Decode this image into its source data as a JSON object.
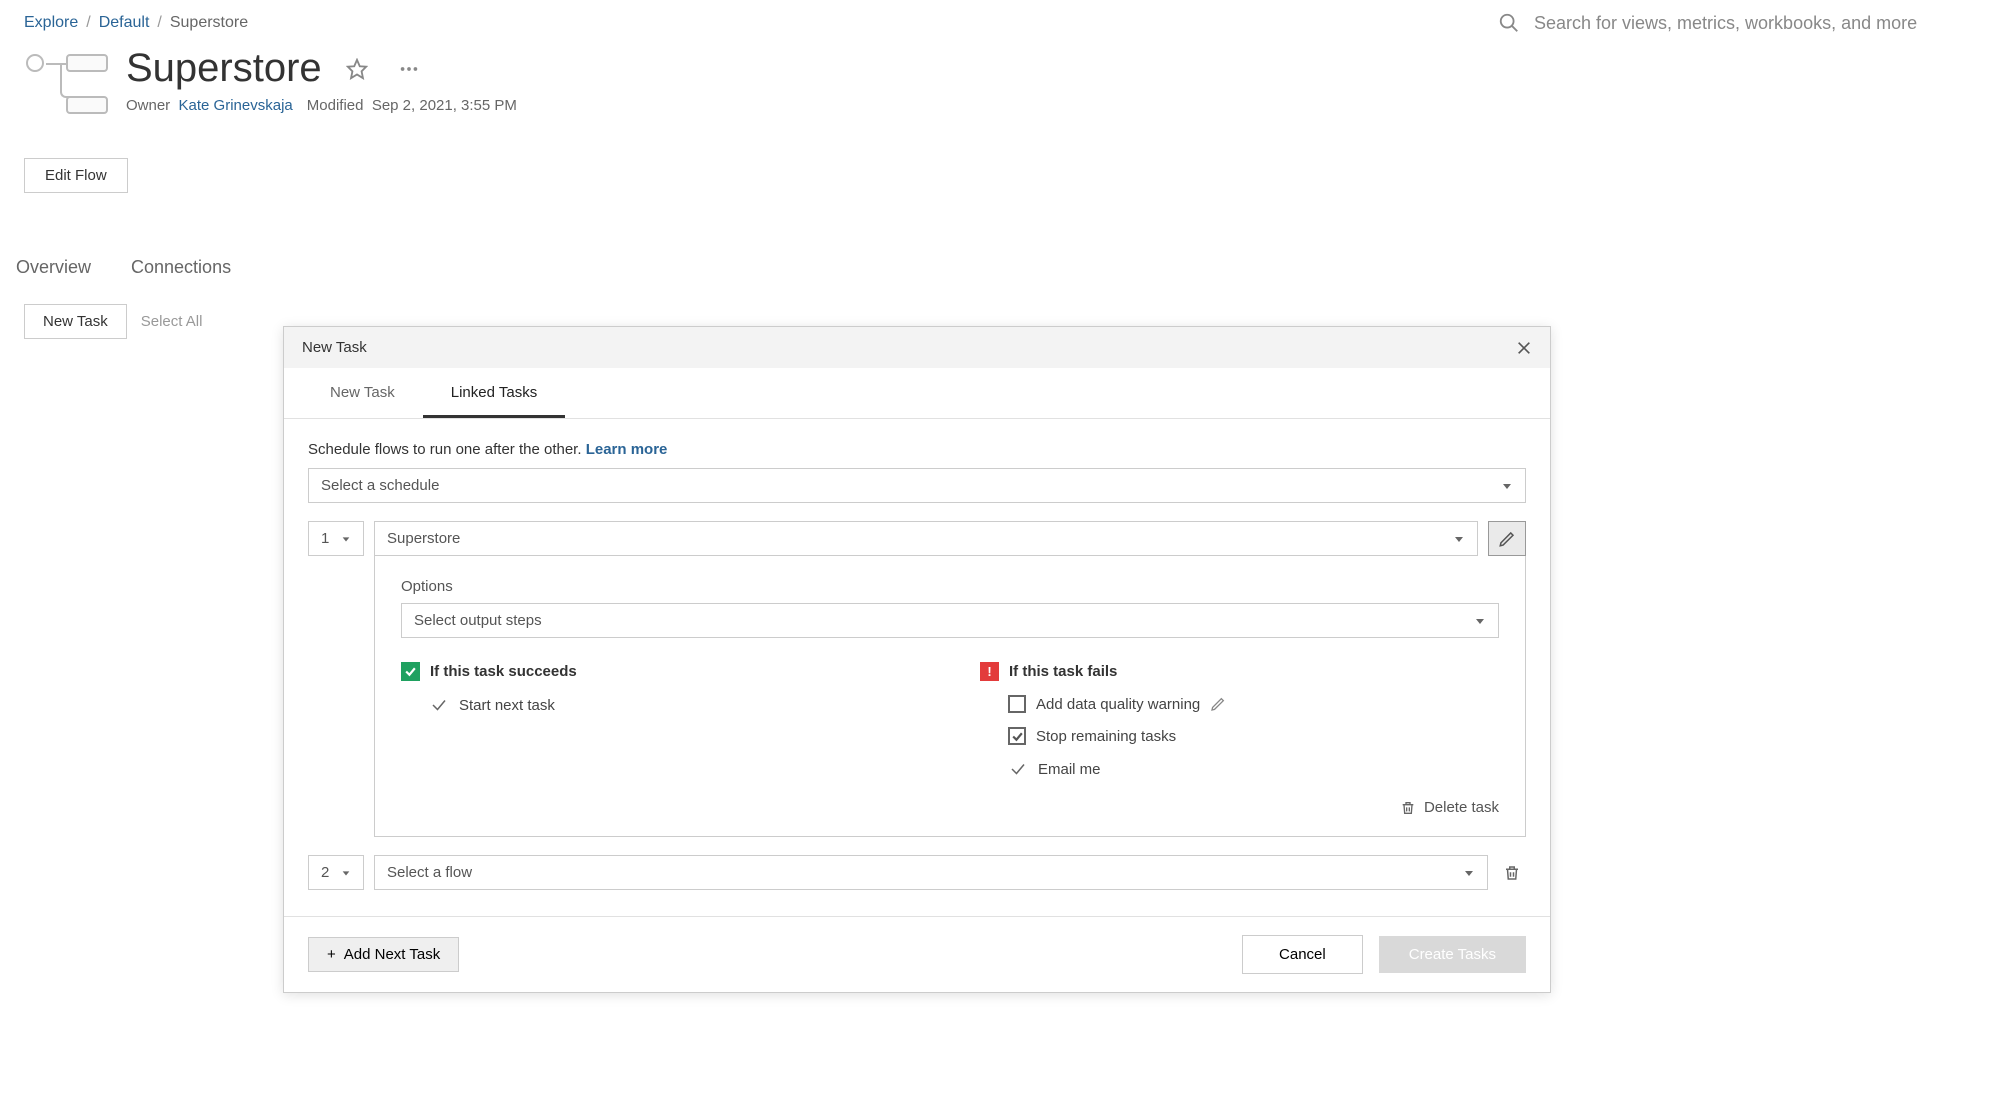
{
  "breadcrumb": {
    "explore": "Explore",
    "default": "Default",
    "current": "Superstore"
  },
  "search": {
    "placeholder": "Search for views, metrics, workbooks, and more"
  },
  "page": {
    "title": "Superstore",
    "owner_label": "Owner",
    "owner_name": "Kate Grinevskaja",
    "modified_label": "Modified",
    "modified_value": "Sep 2, 2021, 3:55 PM",
    "edit_flow": "Edit Flow"
  },
  "tabs": {
    "overview": "Overview",
    "connections": "Connections"
  },
  "toolbar": {
    "new_task": "New Task",
    "select_all": "Select All"
  },
  "dialog": {
    "title": "New Task",
    "tab_new": "New Task",
    "tab_linked": "Linked Tasks",
    "info_text": "Schedule flows to run one after the other.  ",
    "learn_more": "Learn more",
    "schedule_placeholder": "Select a schedule",
    "task1": {
      "index": "1",
      "flow": "Superstore",
      "options_label": "Options",
      "output_placeholder": "Select output steps",
      "success_head": "If this task succeeds",
      "start_next": "Start next task",
      "fail_head": "If this task fails",
      "add_warning": "Add data quality warning",
      "stop_remaining": "Stop remaining tasks",
      "email_me": "Email me",
      "delete": "Delete task"
    },
    "task2": {
      "index": "2",
      "flow_placeholder": "Select a flow"
    },
    "footer": {
      "add_next": "Add Next Task",
      "cancel": "Cancel",
      "create": "Create Tasks"
    }
  }
}
